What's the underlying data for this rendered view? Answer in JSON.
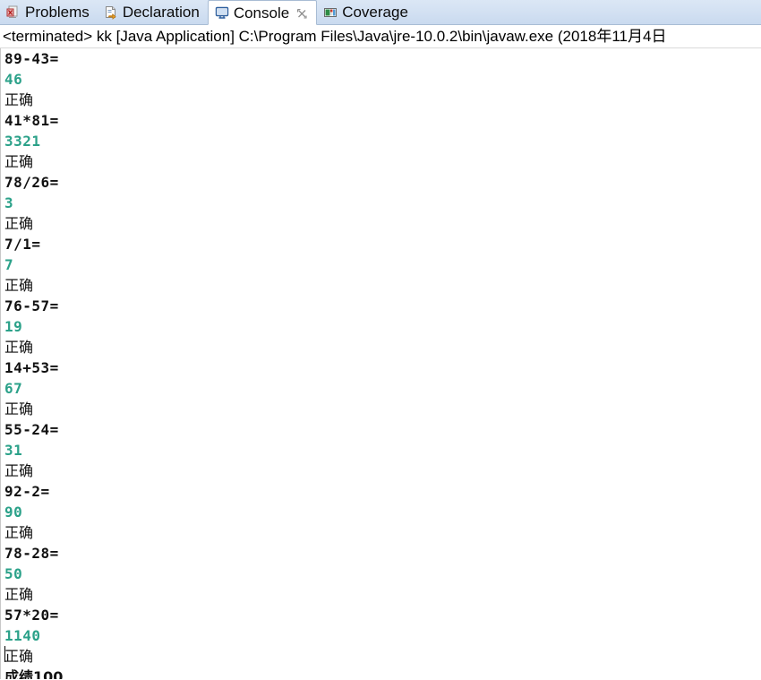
{
  "tabs": [
    {
      "label": "Problems",
      "icon": "problems-icon",
      "active": false,
      "closable": false
    },
    {
      "label": "Declaration",
      "icon": "declaration-icon",
      "active": false,
      "closable": false
    },
    {
      "label": "Console",
      "icon": "console-icon",
      "active": true,
      "closable": true
    },
    {
      "label": "Coverage",
      "icon": "coverage-icon",
      "active": false,
      "closable": false
    }
  ],
  "console": {
    "header": "<terminated> kk [Java Application] C:\\Program Files\\Java\\jre-10.0.2\\bin\\javaw.exe (2018年11月4日",
    "lines": [
      {
        "kind": "expr",
        "text": "89-43="
      },
      {
        "kind": "answer",
        "text": "46"
      },
      {
        "kind": "verdict",
        "text": "正确"
      },
      {
        "kind": "expr",
        "text": "41*81="
      },
      {
        "kind": "answer",
        "text": "3321"
      },
      {
        "kind": "verdict",
        "text": "正确"
      },
      {
        "kind": "expr",
        "text": "78/26="
      },
      {
        "kind": "answer",
        "text": "3"
      },
      {
        "kind": "verdict",
        "text": "正确"
      },
      {
        "kind": "expr",
        "text": "7/1="
      },
      {
        "kind": "answer",
        "text": "7"
      },
      {
        "kind": "verdict",
        "text": "正确"
      },
      {
        "kind": "expr",
        "text": "76-57="
      },
      {
        "kind": "answer",
        "text": "19"
      },
      {
        "kind": "verdict",
        "text": "正确"
      },
      {
        "kind": "expr",
        "text": "14+53="
      },
      {
        "kind": "answer",
        "text": "67"
      },
      {
        "kind": "verdict",
        "text": "正确"
      },
      {
        "kind": "expr",
        "text": "55-24="
      },
      {
        "kind": "answer",
        "text": "31"
      },
      {
        "kind": "verdict",
        "text": "正确"
      },
      {
        "kind": "expr",
        "text": "92-2="
      },
      {
        "kind": "answer",
        "text": "90"
      },
      {
        "kind": "verdict",
        "text": "正确"
      },
      {
        "kind": "expr",
        "text": "78-28="
      },
      {
        "kind": "answer",
        "text": "50"
      },
      {
        "kind": "verdict",
        "text": "正确"
      },
      {
        "kind": "expr",
        "text": "57*20="
      },
      {
        "kind": "answer",
        "text": "1140"
      },
      {
        "kind": "verdict",
        "text": "正确"
      },
      {
        "kind": "score",
        "text": "成绩100"
      }
    ]
  },
  "colors": {
    "answer_green": "#2ba189",
    "text_black": "#111111",
    "tabbar_top": "#dbe7f5",
    "tabbar_bottom": "#c9daef",
    "tab_active_bg": "#ffffff",
    "border": "#a8bcd4"
  }
}
